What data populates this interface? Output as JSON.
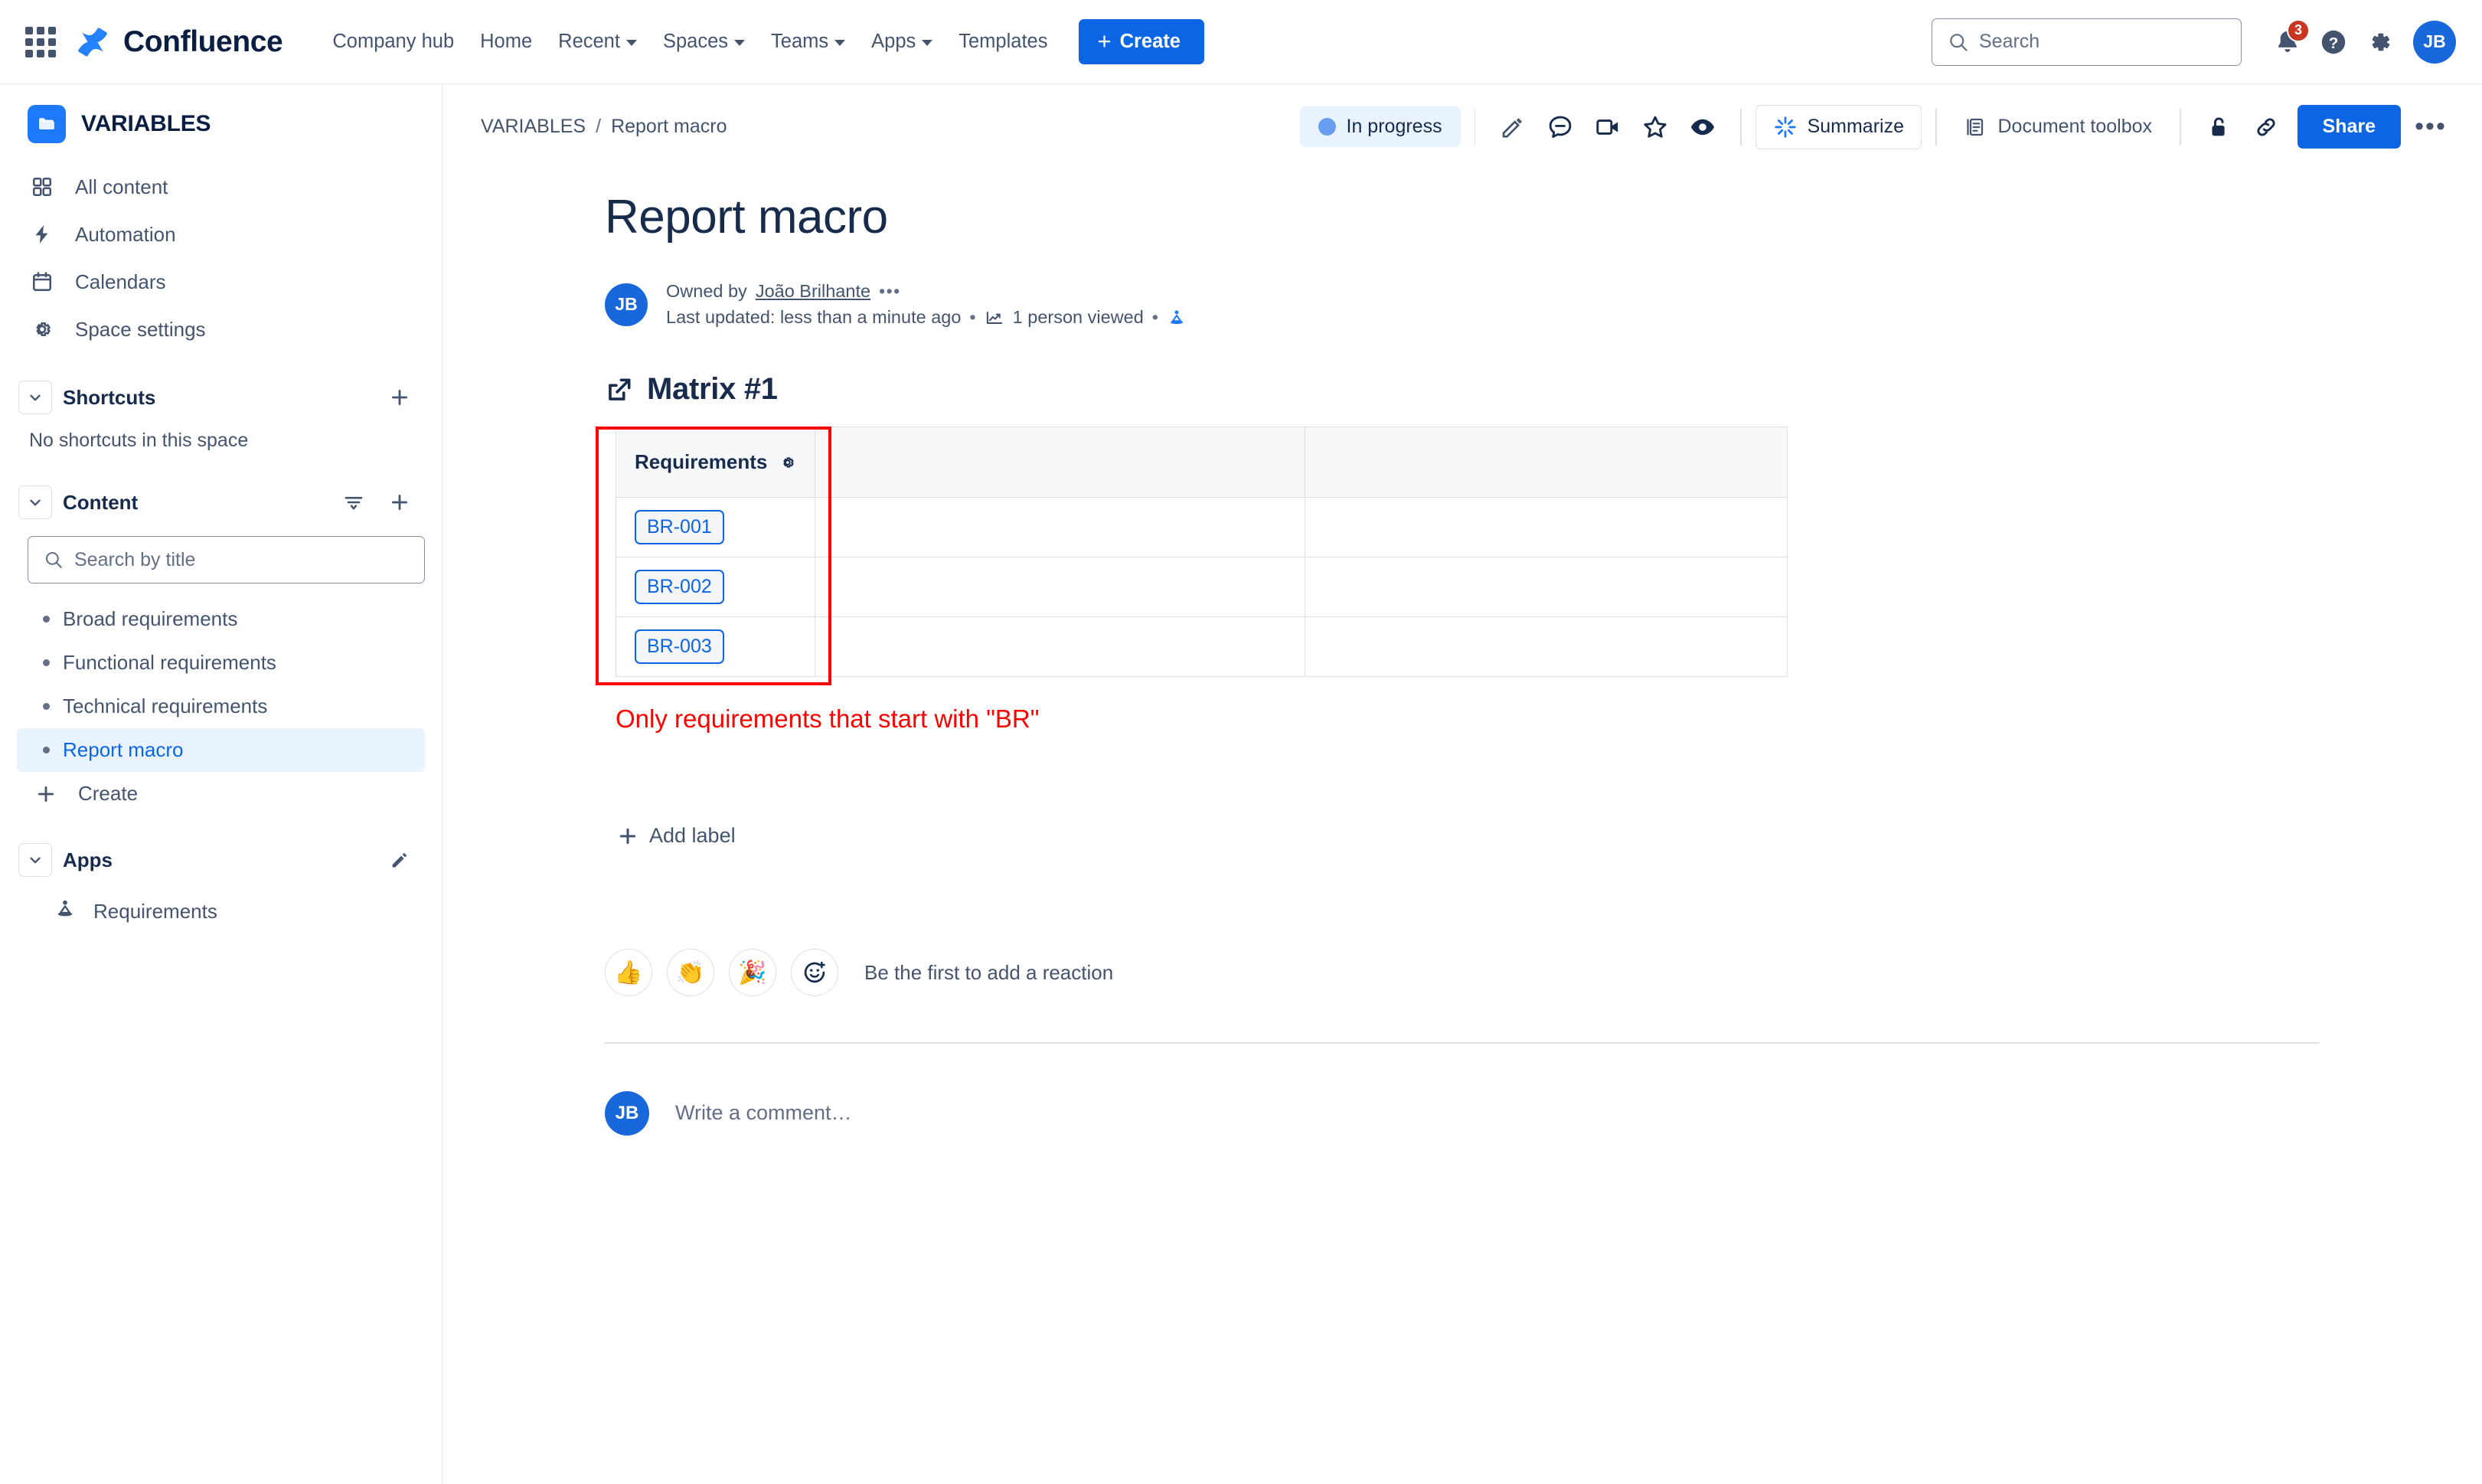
{
  "topnav": {
    "app_name": "Confluence",
    "items": [
      {
        "label": "Company hub",
        "has_caret": false
      },
      {
        "label": "Home",
        "has_caret": false
      },
      {
        "label": "Recent",
        "has_caret": true
      },
      {
        "label": "Spaces",
        "has_caret": true
      },
      {
        "label": "Teams",
        "has_caret": true
      },
      {
        "label": "Apps",
        "has_caret": true
      },
      {
        "label": "Templates",
        "has_caret": false
      }
    ],
    "create_label": "Create",
    "search_placeholder": "Search",
    "notification_count": "3",
    "avatar_initials": "JB"
  },
  "sidebar": {
    "space_name": "VARIABLES",
    "nav": [
      {
        "label": "All content",
        "icon": "grid-icon"
      },
      {
        "label": "Automation",
        "icon": "lightning-icon"
      },
      {
        "label": "Calendars",
        "icon": "calendar-icon"
      },
      {
        "label": "Space settings",
        "icon": "gear-icon"
      }
    ],
    "shortcuts_title": "Shortcuts",
    "shortcuts_empty": "No shortcuts in this space",
    "content_title": "Content",
    "search_placeholder": "Search by title",
    "pages": [
      {
        "label": "Broad requirements",
        "active": false
      },
      {
        "label": "Functional requirements",
        "active": false
      },
      {
        "label": "Technical requirements",
        "active": false
      },
      {
        "label": "Report macro",
        "active": true
      }
    ],
    "create_label": "Create",
    "apps_title": "Apps",
    "apps": [
      {
        "label": "Requirements"
      }
    ]
  },
  "page": {
    "breadcrumb": {
      "space": "VARIABLES",
      "separator": "/",
      "current": "Report macro"
    },
    "status": "In progress",
    "summarize_label": "Summarize",
    "document_toolbox_label": "Document toolbox",
    "share_label": "Share",
    "title": "Report macro",
    "byline": {
      "avatar_initials": "JB",
      "owned_by_prefix": "Owned by",
      "owner": "João Brilhante",
      "last_updated": "Last updated: less than a minute ago",
      "views": "1 person viewed"
    },
    "section_heading": "Matrix #1",
    "table": {
      "columns": [
        "Requirements",
        "",
        ""
      ],
      "rows": [
        [
          "BR-001",
          "",
          ""
        ],
        [
          "BR-002",
          "",
          ""
        ],
        [
          "BR-003",
          "",
          ""
        ]
      ]
    },
    "annotation": "Only requirements that start with \"BR\"",
    "add_label": "Add label",
    "reactions": {
      "emojis": [
        "👍",
        "👏",
        "🎉"
      ],
      "note": "Be the first to add a reaction"
    },
    "comment": {
      "avatar_initials": "JB",
      "placeholder": "Write a comment…"
    }
  },
  "colors": {
    "brand_blue": "#0c66e4",
    "accent_blue": "#1d7afc",
    "status_blue": "#669df1",
    "annotation_red": "#ff0000",
    "badge_red": "#ca3521"
  }
}
